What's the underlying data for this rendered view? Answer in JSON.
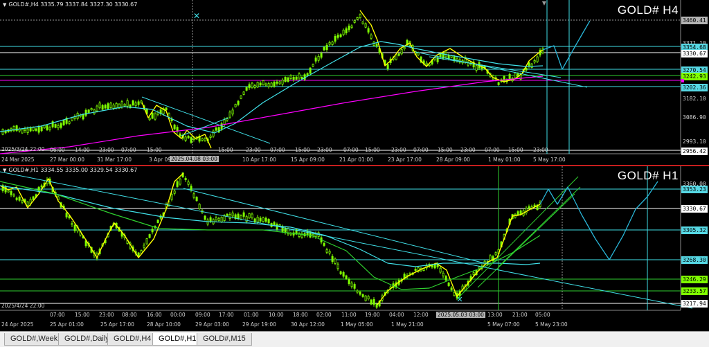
{
  "h4": {
    "info": "GOLD#,H4  3335.79 3337.84 3327.30 3330.67",
    "title": "GOLD# H4",
    "prices": [
      "3460.41",
      "3354.68",
      "3330.67",
      "3270.54",
      "3242.93",
      "3202.36",
      "3182.10",
      "3086.90",
      "2993.10",
      "2956.42",
      "3371.10"
    ],
    "times": [
      "24 Mar 2025",
      "27 Mar 00:00",
      "31 Mar 17:00",
      "3 Apr 09:",
      "2025.04.07 21:00",
      "10 Apr 17:00",
      "15 Apr 09:00",
      "21 Apr 01:00",
      "23 Apr 17:00",
      "28 Apr 09:00",
      "1 May 01:00",
      "5 May 17:00"
    ],
    "hl_time_top": "2025.04.08 03:00",
    "date_start": "2025/3/24 22:00",
    "hours": [
      "06:00",
      "14:00",
      "23:00",
      "07:00",
      "15:00",
      "15:00",
      "23:00",
      "07:00",
      "15:00",
      "23:00",
      "07:00",
      "15:00",
      "23:00",
      "07:00",
      "15:00",
      "23:00",
      "07:00",
      "15:00",
      "23:00"
    ]
  },
  "h1": {
    "info": "GOLD#,H1  3334.55 3335.00 3329.54 3330.67",
    "title": "GOLD# H1",
    "prices": [
      "3360.00",
      "3353.23",
      "3330.67",
      "3305.32",
      "3268.30",
      "3246.29",
      "3233.57",
      "3217.94"
    ],
    "times": [
      "24 Apr 2025",
      "25 Apr 01:00",
      "25 Apr 17:00",
      "28 Apr 10:00",
      "29 Apr 03:00",
      "29 Apr 19:00",
      "30 Apr 12:00",
      "1 May 05:00",
      "1 May 21:00",
      "2025.05.02 21:00",
      "5 May 07:00",
      "5 May 23:00"
    ],
    "hl_time_top": "2025.05.03 03:00",
    "date_start": "2025/4/24 22:00",
    "hours": [
      "07:00",
      "15:00",
      "23:00",
      "08:00",
      "16:00",
      "00:00",
      "09:00",
      "17:00",
      "01:00",
      "10:00",
      "18:00",
      "02:00",
      "11:00",
      "19:00",
      "04:00",
      "12:00",
      "13:00",
      "21:00",
      "05:00"
    ]
  },
  "tabs": [
    "GOLD#,Weekly",
    "GOLD#,Daily",
    "GOLD#,H4",
    "GOLD#,H1",
    "GOLD#,M15"
  ],
  "active_tab": "GOLD#,H1",
  "colors": {
    "background": "#000000",
    "candle": "#7fff00",
    "price_path": "#ffff00",
    "ma_fast": "#40e0e8",
    "ma_slow": "#ff00ff",
    "ma_green": "#2fd12f",
    "projection": "#29b6d8",
    "separator": "#c81e1e"
  }
}
